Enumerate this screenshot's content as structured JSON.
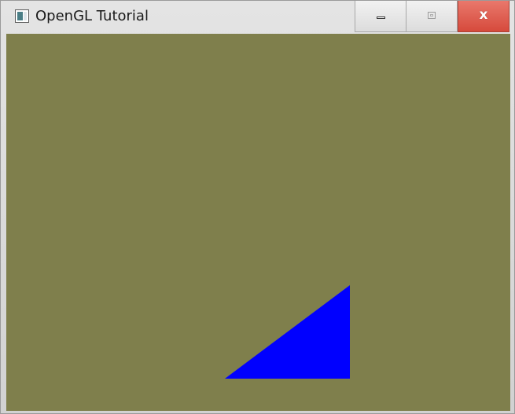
{
  "window": {
    "title": "OpenGL Tutorial",
    "icon": "app-window-icon",
    "controls": {
      "minimize_icon": "minimize-icon",
      "maximize_icon": "maximize-icon",
      "close_label": "x"
    }
  },
  "canvas": {
    "clear_color": "#7f7f4c",
    "triangle_color": "#0000ff"
  }
}
